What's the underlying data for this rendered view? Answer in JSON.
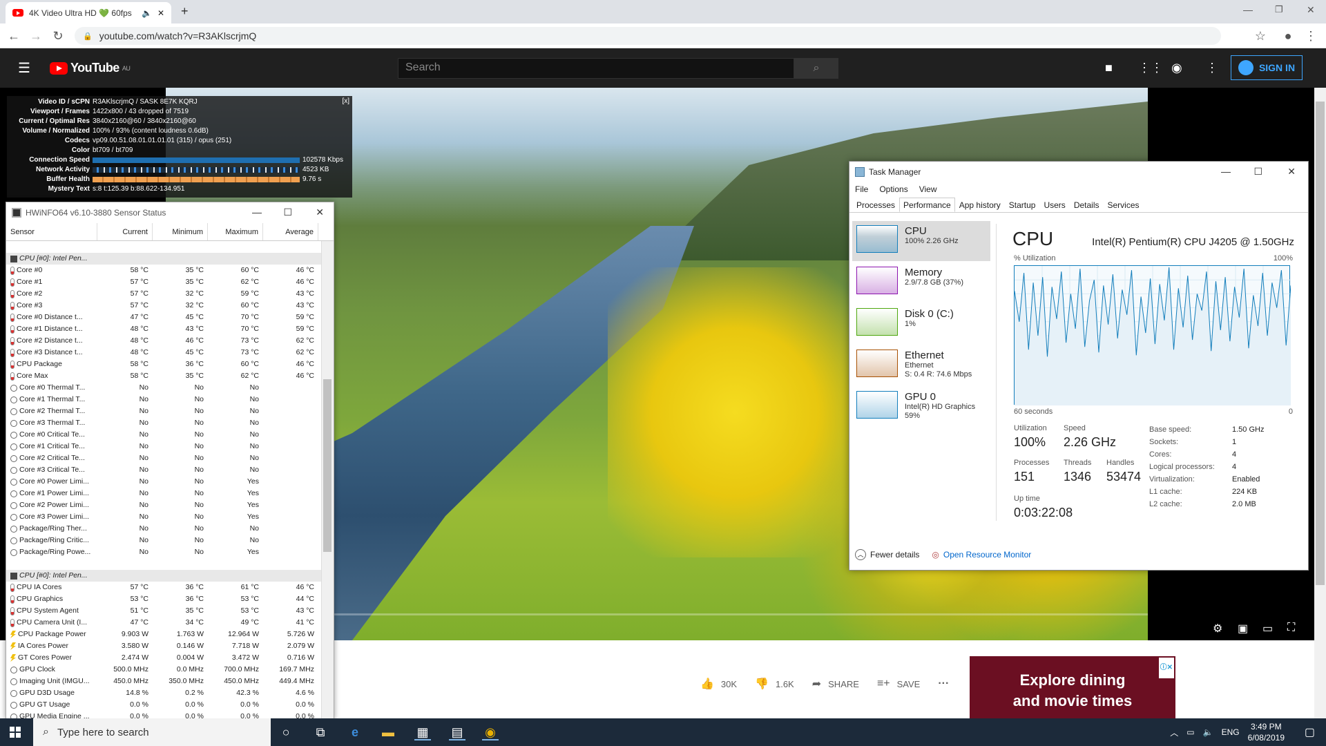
{
  "browser": {
    "tab_title": "4K Video Ultra HD 💚 60fps",
    "new_tab": "+",
    "url": "youtube.com/watch?v=R3AKlscrjmQ"
  },
  "youtube": {
    "logo_text": "YouTube",
    "region": "AU",
    "search_placeholder": "Search",
    "signin_label": "SIGN IN"
  },
  "stats": {
    "close": "[x]",
    "rows": [
      {
        "key": "Video ID / sCPN",
        "value": "R3AKlscrjmQ / SASK 8E7K KQRJ"
      },
      {
        "key": "Viewport / Frames",
        "value": "1422x800 / 43 dropped of 7519"
      },
      {
        "key": "Current / Optimal Res",
        "value": "3840x2160@60 / 3840x2160@60"
      },
      {
        "key": "Volume / Normalized",
        "value": "100% / 93% (content loudness 0.6dB)"
      },
      {
        "key": "Codecs",
        "value": "vp09.00.51.08.01.01.01.01 (315) / opus (251)"
      },
      {
        "key": "Color",
        "value": "bt709 / bt709"
      }
    ],
    "connection_label": "Connection Speed",
    "connection_value": "102578 Kbps",
    "network_label": "Network Activity",
    "network_value": "4523 KB",
    "buffer_label": "Buffer Health",
    "buffer_value": "9.76 s",
    "mystery_label": "Mystery Text",
    "mystery_value": "s:8 t:125.39 b:88.622-134.951"
  },
  "hwinfo": {
    "title": "HWiNFO64 v6.10-3880 Sensor Status",
    "headers": [
      "Sensor",
      "Current",
      "Minimum",
      "Maximum",
      "Average"
    ],
    "group1": "CPU [#0]: Intel Pen...",
    "group2": "CPU [#0]: Intel Pen...",
    "rows1": [
      {
        "icon": "t",
        "name": "Core #0",
        "cur": "58 °C",
        "min": "35 °C",
        "max": "60 °C",
        "avg": "46 °C"
      },
      {
        "icon": "t",
        "name": "Core #1",
        "cur": "57 °C",
        "min": "35 °C",
        "max": "62 °C",
        "avg": "46 °C"
      },
      {
        "icon": "t",
        "name": "Core #2",
        "cur": "57 °C",
        "min": "32 °C",
        "max": "59 °C",
        "avg": "43 °C"
      },
      {
        "icon": "t",
        "name": "Core #3",
        "cur": "57 °C",
        "min": "32 °C",
        "max": "60 °C",
        "avg": "43 °C"
      },
      {
        "icon": "t",
        "name": "Core #0 Distance t...",
        "cur": "47 °C",
        "min": "45 °C",
        "max": "70 °C",
        "avg": "59 °C"
      },
      {
        "icon": "t",
        "name": "Core #1 Distance t...",
        "cur": "48 °C",
        "min": "43 °C",
        "max": "70 °C",
        "avg": "59 °C"
      },
      {
        "icon": "t",
        "name": "Core #2 Distance t...",
        "cur": "48 °C",
        "min": "46 °C",
        "max": "73 °C",
        "avg": "62 °C"
      },
      {
        "icon": "t",
        "name": "Core #3 Distance t...",
        "cur": "48 °C",
        "min": "45 °C",
        "max": "73 °C",
        "avg": "62 °C"
      },
      {
        "icon": "t",
        "name": "CPU Package",
        "cur": "58 °C",
        "min": "36 °C",
        "max": "60 °C",
        "avg": "46 °C"
      },
      {
        "icon": "t",
        "name": "Core Max",
        "cur": "58 °C",
        "min": "35 °C",
        "max": "62 °C",
        "avg": "46 °C"
      },
      {
        "icon": "o",
        "name": "Core #0 Thermal T...",
        "cur": "No",
        "min": "No",
        "max": "No",
        "avg": ""
      },
      {
        "icon": "o",
        "name": "Core #1 Thermal T...",
        "cur": "No",
        "min": "No",
        "max": "No",
        "avg": ""
      },
      {
        "icon": "o",
        "name": "Core #2 Thermal T...",
        "cur": "No",
        "min": "No",
        "max": "No",
        "avg": ""
      },
      {
        "icon": "o",
        "name": "Core #3 Thermal T...",
        "cur": "No",
        "min": "No",
        "max": "No",
        "avg": ""
      },
      {
        "icon": "o",
        "name": "Core #0 Critical Te...",
        "cur": "No",
        "min": "No",
        "max": "No",
        "avg": ""
      },
      {
        "icon": "o",
        "name": "Core #1 Critical Te...",
        "cur": "No",
        "min": "No",
        "max": "No",
        "avg": ""
      },
      {
        "icon": "o",
        "name": "Core #2 Critical Te...",
        "cur": "No",
        "min": "No",
        "max": "No",
        "avg": ""
      },
      {
        "icon": "o",
        "name": "Core #3 Critical Te...",
        "cur": "No",
        "min": "No",
        "max": "No",
        "avg": ""
      },
      {
        "icon": "o",
        "name": "Core #0 Power Limi...",
        "cur": "No",
        "min": "No",
        "max": "Yes",
        "avg": ""
      },
      {
        "icon": "o",
        "name": "Core #1 Power Limi...",
        "cur": "No",
        "min": "No",
        "max": "Yes",
        "avg": ""
      },
      {
        "icon": "o",
        "name": "Core #2 Power Limi...",
        "cur": "No",
        "min": "No",
        "max": "Yes",
        "avg": ""
      },
      {
        "icon": "o",
        "name": "Core #3 Power Limi...",
        "cur": "No",
        "min": "No",
        "max": "Yes",
        "avg": ""
      },
      {
        "icon": "o",
        "name": "Package/Ring Ther...",
        "cur": "No",
        "min": "No",
        "max": "No",
        "avg": ""
      },
      {
        "icon": "o",
        "name": "Package/Ring Critic...",
        "cur": "No",
        "min": "No",
        "max": "No",
        "avg": ""
      },
      {
        "icon": "o",
        "name": "Package/Ring Powe...",
        "cur": "No",
        "min": "No",
        "max": "Yes",
        "avg": ""
      }
    ],
    "rows2": [
      {
        "icon": "t",
        "name": "CPU IA Cores",
        "cur": "57 °C",
        "min": "36 °C",
        "max": "61 °C",
        "avg": "46 °C"
      },
      {
        "icon": "t",
        "name": "CPU Graphics",
        "cur": "53 °C",
        "min": "36 °C",
        "max": "53 °C",
        "avg": "44 °C"
      },
      {
        "icon": "t",
        "name": "CPU System Agent",
        "cur": "51 °C",
        "min": "35 °C",
        "max": "53 °C",
        "avg": "43 °C"
      },
      {
        "icon": "t",
        "name": "CPU Camera Unit (I...",
        "cur": "47 °C",
        "min": "34 °C",
        "max": "49 °C",
        "avg": "41 °C"
      },
      {
        "icon": "p",
        "name": "CPU Package Power",
        "cur": "9.903 W",
        "min": "1.763 W",
        "max": "12.964 W",
        "avg": "5.726 W"
      },
      {
        "icon": "p",
        "name": "IA Cores Power",
        "cur": "3.580 W",
        "min": "0.146 W",
        "max": "7.718 W",
        "avg": "2.079 W"
      },
      {
        "icon": "p",
        "name": "GT Cores Power",
        "cur": "2.474 W",
        "min": "0.004 W",
        "max": "3.472 W",
        "avg": "0.716 W"
      },
      {
        "icon": "o",
        "name": "GPU Clock",
        "cur": "500.0 MHz",
        "min": "0.0 MHz",
        "max": "700.0 MHz",
        "avg": "169.7 MHz"
      },
      {
        "icon": "o",
        "name": "Imaging Unit (IMGU...",
        "cur": "450.0 MHz",
        "min": "350.0 MHz",
        "max": "450.0 MHz",
        "avg": "449.4 MHz"
      },
      {
        "icon": "o",
        "name": "GPU D3D Usage",
        "cur": "14.8 %",
        "min": "0.2 %",
        "max": "42.3 %",
        "avg": "4.6 %"
      },
      {
        "icon": "o",
        "name": "GPU GT Usage",
        "cur": "0.0 %",
        "min": "0.0 %",
        "max": "0.0 %",
        "avg": "0.0 %"
      },
      {
        "icon": "o",
        "name": "GPU Media Engine ...",
        "cur": "0.0 %",
        "min": "0.0 %",
        "max": "0.0 %",
        "avg": "0.0 %"
      }
    ]
  },
  "taskmgr": {
    "title": "Task Manager",
    "menu": [
      "File",
      "Options",
      "View"
    ],
    "tabs": [
      "Processes",
      "Performance",
      "App history",
      "Startup",
      "Users",
      "Details",
      "Services"
    ],
    "resources": [
      {
        "name": "CPU",
        "sub1": "100% 2.26 GHz",
        "sub2": "",
        "sub3": "",
        "color": "#117dbb"
      },
      {
        "name": "Memory",
        "sub1": "2.9/7.8 GB (37%)",
        "sub2": "",
        "sub3": "",
        "color": "#8b12ae"
      },
      {
        "name": "Disk 0 (C:)",
        "sub1": "1%",
        "sub2": "",
        "sub3": "",
        "color": "#4da60c"
      },
      {
        "name": "Ethernet",
        "sub1": "Ethernet",
        "sub2": "S: 0.4  R: 74.6 Mbps",
        "sub3": "",
        "color": "#a74f01"
      },
      {
        "name": "GPU 0",
        "sub1": "Intel(R) HD Graphics",
        "sub2": "59%",
        "sub3": "",
        "color": "#117dbb"
      }
    ],
    "cpu_heading": "CPU",
    "cpu_model": "Intel(R) Pentium(R) CPU J4205 @ 1.50GHz",
    "util_label": "% Utilization",
    "util_max": "100%",
    "time_label": "60 seconds",
    "zero_label": "0",
    "stats": {
      "utilization_label": "Utilization",
      "utilization": "100%",
      "speed_label": "Speed",
      "speed": "2.26 GHz",
      "processes_label": "Processes",
      "processes": "151",
      "threads_label": "Threads",
      "threads": "1346",
      "handles_label": "Handles",
      "handles": "53474",
      "uptime_label": "Up time",
      "uptime": "0:03:22:08"
    },
    "specs": [
      {
        "k": "Base speed:",
        "v": "1.50 GHz"
      },
      {
        "k": "Sockets:",
        "v": "1"
      },
      {
        "k": "Cores:",
        "v": "4"
      },
      {
        "k": "Logical processors:",
        "v": "4"
      },
      {
        "k": "Virtualization:",
        "v": "Enabled"
      },
      {
        "k": "L1 cache:",
        "v": "224 KB"
      },
      {
        "k": "L2 cache:",
        "v": "2.0 MB"
      }
    ],
    "fewer_details": "Fewer details",
    "open_resource_monitor": "Open Resource Monitor",
    "cpu_history": [
      82,
      60,
      95,
      40,
      88,
      50,
      92,
      35,
      85,
      62,
      96,
      45,
      80,
      55,
      98,
      42,
      75,
      90,
      38,
      86,
      58,
      94,
      48,
      83,
      65,
      97,
      36,
      78,
      52,
      91,
      44,
      87,
      61,
      99,
      40,
      84,
      56,
      93,
      47,
      80,
      68,
      96,
      39,
      89,
      54,
      92,
      46,
      85,
      63,
      98,
      41,
      79,
      57,
      95,
      50,
      88,
      70,
      97,
      43,
      86
    ]
  },
  "video_below": {
    "likes": "30K",
    "dislikes": "1.6K",
    "share": "SHARE",
    "save": "SAVE",
    "more": "···"
  },
  "ad": {
    "line1": "Explore dining",
    "line2": "and movie times"
  },
  "taskbar": {
    "search_placeholder": "Type here to search",
    "lang": "ENG",
    "time": "3:49 PM",
    "date": "6/08/2019"
  }
}
